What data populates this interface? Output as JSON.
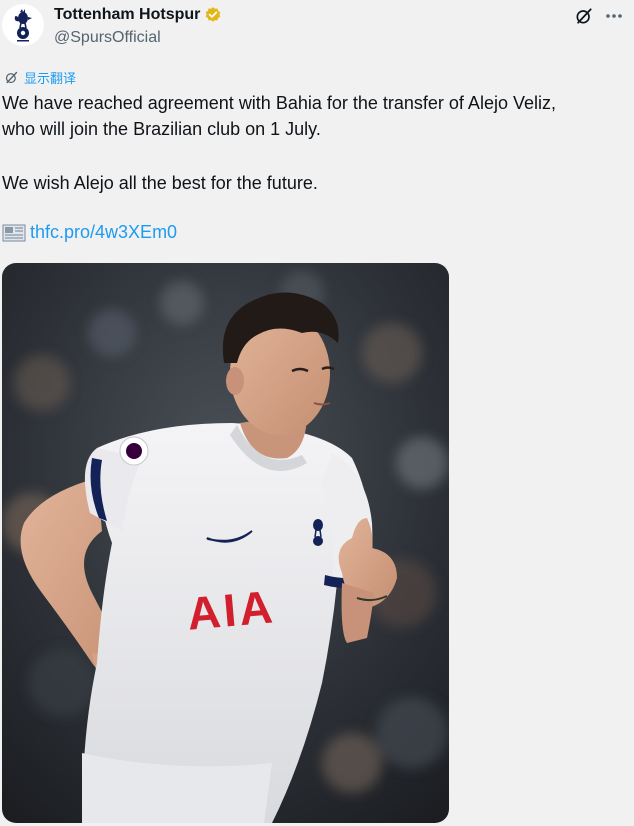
{
  "author": {
    "name": "Tottenham Hotspur",
    "handle": "@SpursOfficial",
    "verified": true
  },
  "translate": {
    "label": "显示翻译"
  },
  "tweet": {
    "line1": "We have reached agreement with Bahia for the transfer of Alejo Veliz,",
    "line2": "who will join the Brazilian club on 1 July.",
    "paragraph2": "We wish Alejo all the best for the future.",
    "link": "thfc.pro/4w3XEm0"
  },
  "media": {
    "shirt_sponsor": "AIA"
  },
  "colors": {
    "background": "#f1f1f1",
    "link": "#1d9bf0",
    "verified_badge": "#e2b719",
    "secondary_text": "#536471"
  },
  "icons": [
    "spurs-crest-icon",
    "verified-badge-icon",
    "grok-icon",
    "more-options-icon",
    "translate-icon",
    "newspaper-icon"
  ]
}
